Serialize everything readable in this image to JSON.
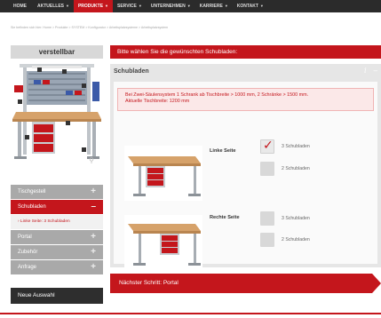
{
  "nav": {
    "items": [
      {
        "label": "HOME",
        "caret": ""
      },
      {
        "label": "AKTUELLES",
        "caret": "▼"
      },
      {
        "label": "PRODUKTE",
        "caret": "▼"
      },
      {
        "label": "SERVICE",
        "caret": "▼"
      },
      {
        "label": "UNTERNEHMEN",
        "caret": "▼"
      },
      {
        "label": "KARRIERE",
        "caret": "▼"
      },
      {
        "label": "KONTAKT",
        "caret": "▼"
      }
    ],
    "active_index": 2,
    "accent_color": "#c4161c"
  },
  "breadcrumb": "Sie befinden sich hier: Home > Produkte > SYSTEM > Konfigurator > Arbeitsplatzsysteme > Arbeitsplatzsystem",
  "sidebar": {
    "header": "verstellbar",
    "zoom_icon": "magnifier-icon",
    "items": [
      {
        "label": "Tischgestell",
        "toggle": "+"
      },
      {
        "label": "Schubladen",
        "toggle": "–"
      },
      {
        "label": "Portal",
        "toggle": "+"
      },
      {
        "label": "Zubehör",
        "toggle": "+"
      },
      {
        "label": "Anfrage",
        "toggle": "+"
      }
    ],
    "sub_item": "› Linke Seite: 3 Schubladen",
    "new_selection": "Neue Auswahl"
  },
  "prompt": "Bitte wählen Sie die gewünschten Schubladen:",
  "section": {
    "title": "Schubladen",
    "info_icon": "i",
    "collapse_icon": "–",
    "info_line1": "Bei Zwei-Säulensystem 1 Schrank ab Tischbreite > 1000 mm, 2 Schränke > 1500 mm.",
    "info_line2": "Aktuelle Tischbreite: 1200 mm",
    "left_label": "Linke Seite",
    "right_label": "Rechte Seite",
    "left_options": [
      {
        "label": "3 Schubladen",
        "checked": true
      },
      {
        "label": "2 Schubladen",
        "checked": false
      }
    ],
    "right_options": [
      {
        "label": "3 Schubladen",
        "checked": false
      },
      {
        "label": "2 Schubladen",
        "checked": false
      }
    ]
  },
  "next_step": "Nächster Schritt: Portal"
}
